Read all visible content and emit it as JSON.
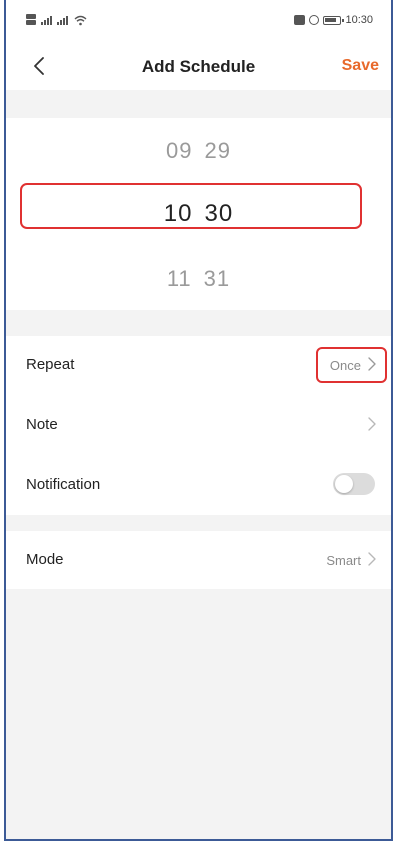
{
  "status_bar": {
    "time": "10:30"
  },
  "header": {
    "title": "Add Schedule",
    "save_label": "Save"
  },
  "time_picker": {
    "previous": {
      "hour": "09",
      "minute": "29"
    },
    "selected": {
      "hour": "10",
      "minute": "30"
    },
    "next": {
      "hour": "11",
      "minute": "31"
    }
  },
  "settings": {
    "repeat": {
      "label": "Repeat",
      "value": "Once"
    },
    "note": {
      "label": "Note",
      "value": ""
    },
    "notification": {
      "label": "Notification",
      "enabled": false
    },
    "mode": {
      "label": "Mode",
      "value": "Smart"
    }
  },
  "colors": {
    "accent": "#e8692b",
    "highlight_box": "#e03131",
    "background": "#f3f3f3",
    "toggle_off": "#dcdcdc"
  },
  "icons": [
    "back-chevron-icon",
    "chevron-right-icon",
    "toggle-switch",
    "battery-icon",
    "wifi-icon",
    "signal-icon",
    "nfc-icon",
    "clock-icon"
  ]
}
